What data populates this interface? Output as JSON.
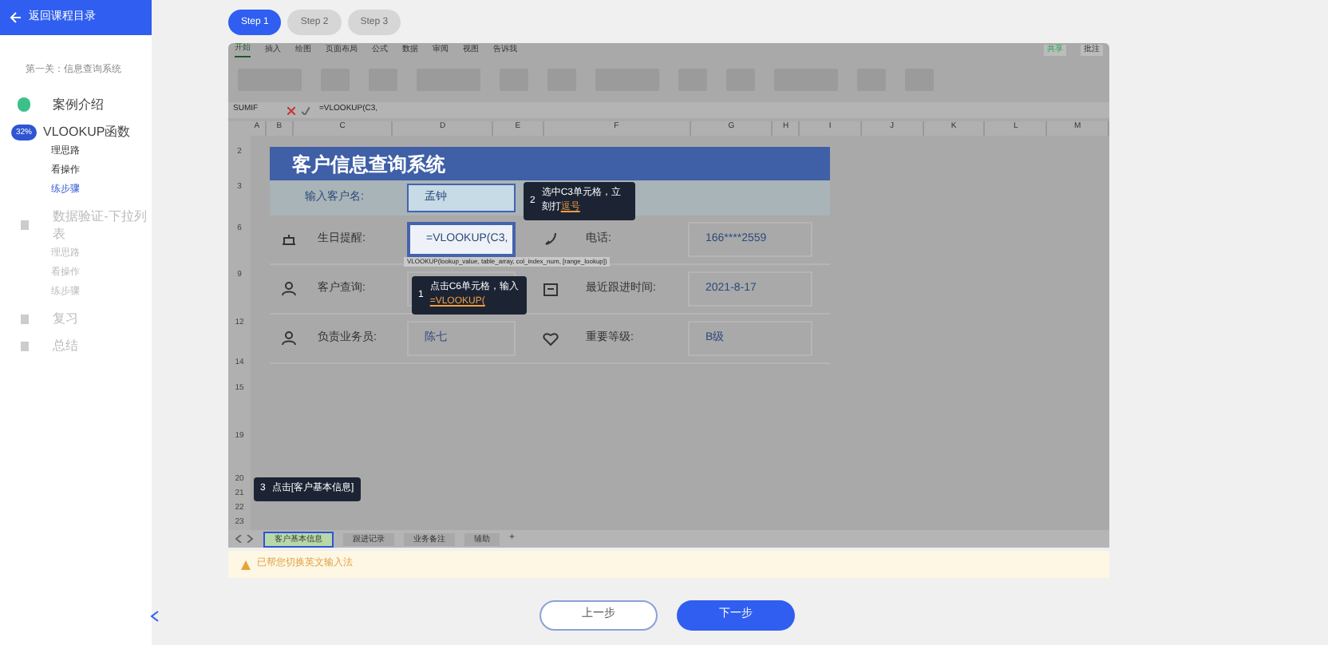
{
  "sidebar": {
    "back": "返回课程目录",
    "chapter": "第一关：信息查询系统",
    "lessons": [
      {
        "title": "案例介绍",
        "completed": true,
        "selected": false,
        "locked": false
      },
      {
        "title": "VLOOKUP函数",
        "completed": false,
        "selected": true,
        "locked": false,
        "progress": "32%",
        "steps": [
          {
            "label": "理思路",
            "selected": false
          },
          {
            "label": "看操作",
            "selected": false
          },
          {
            "label": "练步骤",
            "selected": true
          }
        ]
      },
      {
        "title": "数据验证-下拉列表",
        "completed": false,
        "selected": false,
        "locked": true,
        "steps": [
          {
            "label": "理思路",
            "selected": false
          },
          {
            "label": "看操作",
            "selected": false
          },
          {
            "label": "练步骤",
            "selected": false
          }
        ]
      },
      {
        "title": "复习",
        "completed": false,
        "selected": false,
        "locked": true
      },
      {
        "title": "总结",
        "completed": false,
        "selected": false,
        "locked": true
      }
    ]
  },
  "steps": [
    {
      "label": "Step 1",
      "selected": true
    },
    {
      "label": "Step 2",
      "selected": false
    },
    {
      "label": "Step 3",
      "selected": false
    }
  ],
  "excel": {
    "ribbon_tabs": [
      {
        "label": "开始",
        "selected": true
      },
      {
        "label": "插入",
        "selected": false
      },
      {
        "label": "绘图",
        "selected": false
      },
      {
        "label": "页面布局",
        "selected": false
      },
      {
        "label": "公式",
        "selected": false
      },
      {
        "label": "数据",
        "selected": false
      },
      {
        "label": "审阅",
        "selected": false
      },
      {
        "label": "视图",
        "selected": false
      }
    ],
    "tell_me": "告诉我",
    "share": "共享",
    "comments": "批注",
    "name_box": "SUMIF",
    "formula": "=VLOOKUP(C3,",
    "columns": [
      "A",
      "B",
      "C",
      "D",
      "E",
      "F",
      "G",
      "H",
      "I",
      "J",
      "K",
      "L",
      "M"
    ],
    "row_numbers": [
      "2",
      "3",
      "6",
      "9",
      "12",
      "14",
      "15",
      "19",
      "20",
      "21",
      "22",
      "23"
    ],
    "sheet": {
      "title": "客户信息查询系统",
      "input_label": "输入客户名:",
      "input_value": "孟钟",
      "fields": [
        {
          "label": "生日提醒:",
          "value": "=VLOOKUP(C3,",
          "editing": true,
          "label2": "电话:",
          "value2": "166****2559"
        },
        {
          "label": "客户查询:",
          "editing": false,
          "label2": "最近跟进时间:",
          "value2": "2021-8-17"
        },
        {
          "label": "负责业务员:",
          "value": "陈七",
          "editing": false,
          "label2": "重要等级:",
          "value2": "B级"
        }
      ],
      "tooltip": "VLOOKUP(lookup_value, table_array, col_index_num, [range_lookup])"
    },
    "sheet_tabs": [
      {
        "label": "客户基本信息",
        "selected": true
      },
      {
        "label": "跟进记录",
        "selected": false
      },
      {
        "label": "业务备注",
        "selected": false
      },
      {
        "label": "辅助",
        "selected": false
      }
    ],
    "add_sheet": "+",
    "callouts": [
      {
        "number": "1",
        "text": "点击C6单元格，输入**=VLOOKUP(**"
      },
      {
        "number": "2",
        "text": "选中C3单元格，立刻打**逗号**"
      },
      {
        "number": "3",
        "text": "点击[客户基本信息]"
      }
    ]
  },
  "notice": "已帮您切换英文输入法",
  "buttons": [
    {
      "label": "上一步",
      "kind": "secondary"
    },
    {
      "label": "下一步",
      "kind": "primary"
    }
  ]
}
